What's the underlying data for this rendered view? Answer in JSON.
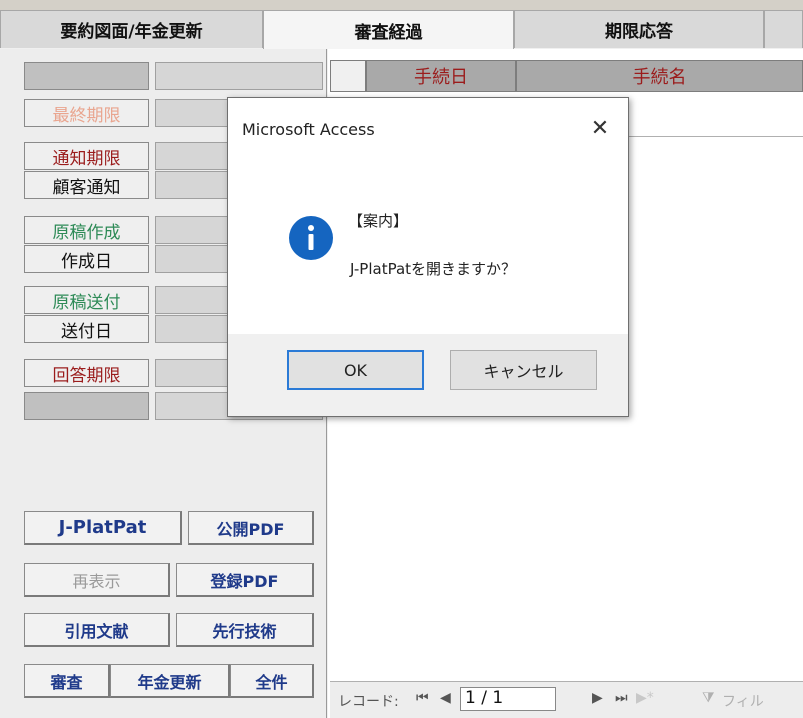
{
  "tabs": [
    "要約図面/年金更新",
    "審査経過",
    "期限応答"
  ],
  "left_labels": {
    "final_deadline": "最終期限",
    "notice_deadline": "通知期限",
    "client_notice": "顧客通知",
    "draft_creation": "原稿作成",
    "creation_date": "作成日",
    "draft_sending": "原稿送付",
    "sent_date": "送付日",
    "reply_deadline": "回答期限"
  },
  "grid": {
    "header_col1": "手続日",
    "header_col2": "手続名"
  },
  "buttons": {
    "jplatpat": "J-PlatPat",
    "public_pdf": "公開PDF",
    "redisplay": "再表示",
    "registered_pdf": "登録PDF",
    "cited_docs": "引用文献",
    "prior_art": "先行技術",
    "examination": "審査",
    "annuity_renewal": "年金更新",
    "all": "全件"
  },
  "navigation": {
    "record_label": "レコード:",
    "record_value": "1 / 1",
    "filter_label": "フィル"
  },
  "dialog": {
    "title": "Microsoft Access",
    "close_glyph": "✕",
    "heading": "【案内】",
    "message": "J-PlatPatを開きますか？",
    "ok_label": "OK",
    "cancel_label": "キャンセル",
    "icon": "info-icon"
  },
  "colors": {
    "label_red": "#9b1c1c",
    "label_green": "#2e8b57",
    "button_blue": "#1f3a8a",
    "info_blue": "#1565c0"
  }
}
